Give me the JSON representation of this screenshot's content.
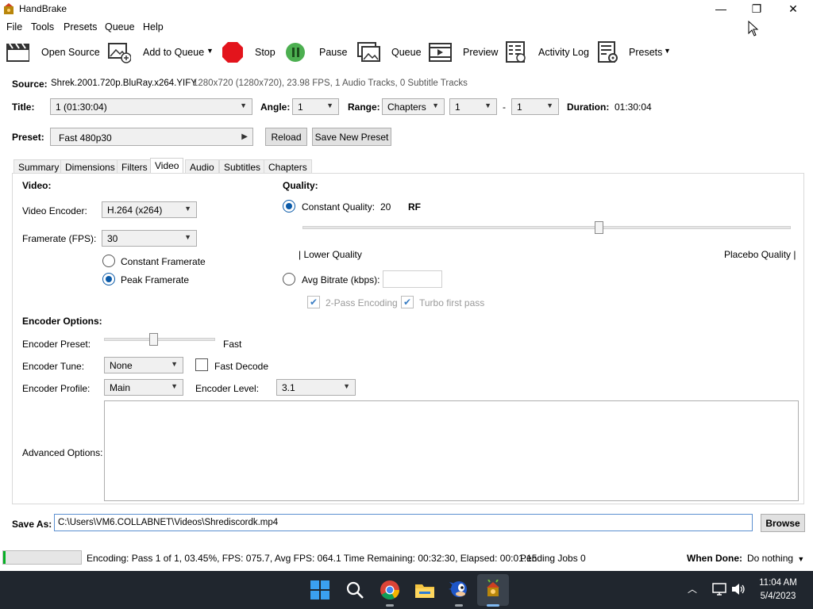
{
  "window": {
    "title": "HandBrake"
  },
  "menu": [
    "File",
    "Tools",
    "Presets",
    "Queue",
    "Help"
  ],
  "toolbar": {
    "open_source": "Open Source",
    "add_to_queue": "Add to Queue",
    "stop": "Stop",
    "pause": "Pause",
    "queue": "Queue",
    "preview": "Preview",
    "activity_log": "Activity Log",
    "presets": "Presets"
  },
  "source": {
    "label": "Source:",
    "name": "Shrek.2001.720p.BluRay.x264.YIFY",
    "info": "1280x720 (1280x720), 23.98 FPS, 1 Audio Tracks, 0 Subtitle Tracks"
  },
  "title_row": {
    "title_label": "Title:",
    "title_value": "1  (01:30:04)",
    "angle_label": "Angle:",
    "angle_value": "1",
    "range_label": "Range:",
    "range_type": "Chapters",
    "range_start": "1",
    "range_sep": "-",
    "range_end": "1",
    "duration_label": "Duration:",
    "duration_value": "01:30:04"
  },
  "preset": {
    "label": "Preset:",
    "value": "Fast 480p30",
    "reload": "Reload",
    "save_new": "Save New Preset"
  },
  "tabs": [
    "Summary",
    "Dimensions",
    "Filters",
    "Video",
    "Audio",
    "Subtitles",
    "Chapters"
  ],
  "video": {
    "heading": "Video:",
    "encoder_label": "Video Encoder:",
    "encoder_value": "H.264 (x264)",
    "fps_label": "Framerate (FPS):",
    "fps_value": "30",
    "constant_framerate": "Constant Framerate",
    "peak_framerate": "Peak Framerate"
  },
  "quality": {
    "heading": "Quality:",
    "constant_quality": "Constant Quality:",
    "cq_value": "20",
    "cq_unit": "RF",
    "lower": "| Lower Quality",
    "placebo": "Placebo Quality |",
    "avg_bitrate": "Avg Bitrate (kbps):",
    "two_pass": "2-Pass Encoding",
    "turbo": "Turbo first pass"
  },
  "encoder_options": {
    "heading": "Encoder Options:",
    "preset_label": "Encoder Preset:",
    "preset_value": "Fast",
    "tune_label": "Encoder Tune:",
    "tune_value": "None",
    "fast_decode": "Fast Decode",
    "profile_label": "Encoder Profile:",
    "profile_value": "Main",
    "level_label": "Encoder Level:",
    "level_value": "3.1",
    "advanced_label": "Advanced Options:"
  },
  "save": {
    "label": "Save As:",
    "path": "C:\\Users\\VM6.COLLABNET\\Videos\\Shrediscordk.mp4",
    "browse": "Browse"
  },
  "status": {
    "text": "Encoding: Pass 1 of 1,  03.45%, FPS: 075.7,  Avg FPS: 064.1 Time Remaining: 00:32:30,  Elapsed: 00:01:15",
    "pending": "Pending Jobs 0",
    "when_done_label": "When Done:",
    "when_done_value": "Do nothing",
    "progress_fraction": 0.0345
  },
  "taskbar": {
    "time": "11:04 AM",
    "date": "5/4/2023"
  },
  "colors": {
    "accent": "#0a5aa8",
    "stop": "#e3141c",
    "pause": "#4caf50",
    "taskbar": "#20262e"
  }
}
